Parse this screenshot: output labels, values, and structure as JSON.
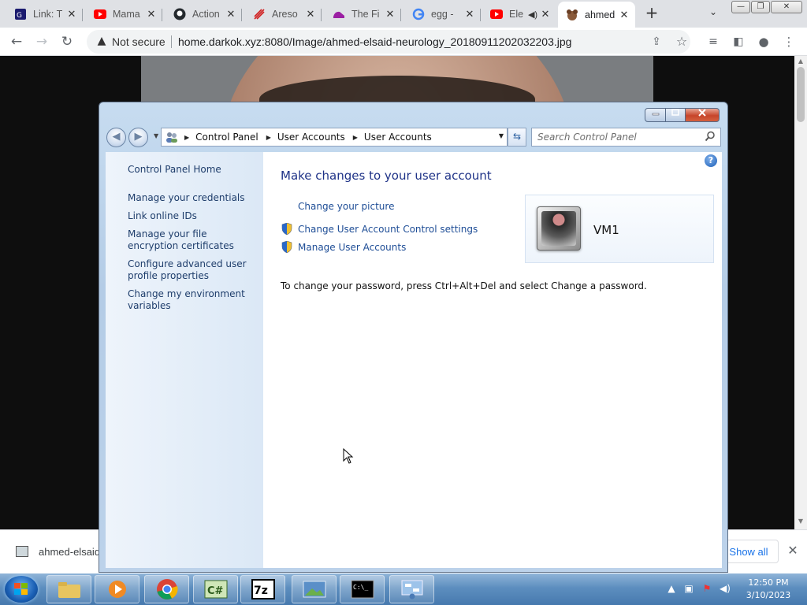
{
  "browser": {
    "tabs": [
      {
        "title": "Link: T",
        "icon": "link-favicon"
      },
      {
        "title": "Mama",
        "icon": "youtube-icon"
      },
      {
        "title": "Action",
        "icon": "github-icon"
      },
      {
        "title": "Areso",
        "icon": "areson-favicon"
      },
      {
        "title": "The Fi",
        "icon": "shoe-favicon"
      },
      {
        "title": "egg - ",
        "icon": "google-icon"
      },
      {
        "title": "Ele",
        "icon": "youtube-icon"
      },
      {
        "title": "ahmed",
        "icon": "dog-favicon"
      }
    ],
    "security_label": "Not secure",
    "url": "home.darkok.xyz:8080/Image/ahmed-elsaid-neurology_20180911202032203.jpg"
  },
  "download_bar": {
    "file_name": "ahmed-elsaid",
    "show_all": "Show all"
  },
  "window": {
    "breadcrumb": [
      "Control Panel",
      "User Accounts",
      "User Accounts"
    ],
    "search_placeholder": "Search Control Panel",
    "left_links": [
      "Control Panel Home",
      "Manage your credentials",
      "Link online IDs",
      "Manage your file encryption certificates",
      "Configure advanced user profile properties",
      "Change my environment variables"
    ],
    "main": {
      "title": "Make changes to your user account",
      "actions": [
        "Change your picture",
        "Change User Account Control settings",
        "Manage User Accounts"
      ],
      "account_name": "VM1",
      "password_note": "To change your password, press Ctrl+Alt+Del and select Change a password."
    }
  },
  "taskbar": {
    "time": "12:50 PM",
    "date": "3/10/2023"
  },
  "colors": {
    "link": "#1e4d96",
    "title": "#1e3287",
    "accent": "#1a73e8"
  }
}
